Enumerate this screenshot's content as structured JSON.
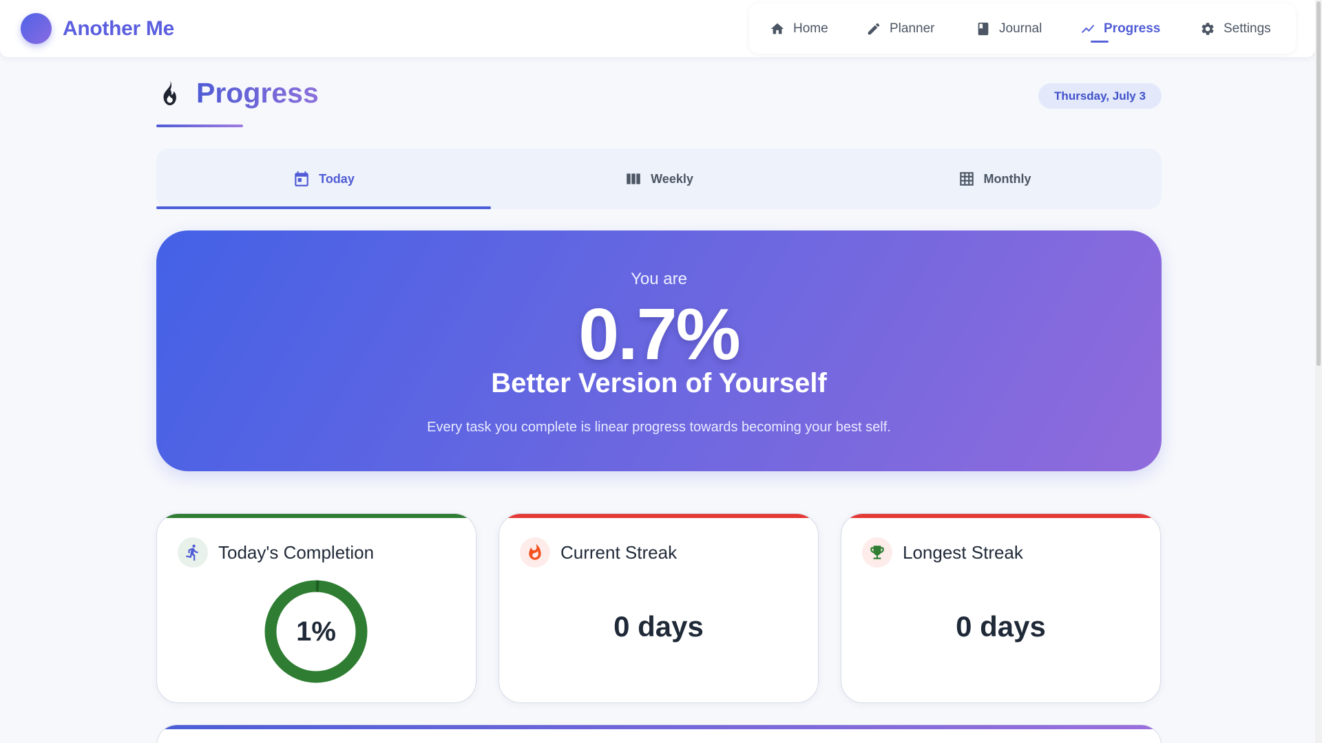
{
  "app": {
    "name": "Another Me"
  },
  "nav": {
    "items": [
      {
        "label": "Home",
        "icon": "home-icon"
      },
      {
        "label": "Planner",
        "icon": "pencil-icon"
      },
      {
        "label": "Journal",
        "icon": "book-icon"
      },
      {
        "label": "Progress",
        "icon": "trending-up-icon",
        "active": true
      },
      {
        "label": "Settings",
        "icon": "gear-icon"
      }
    ]
  },
  "page": {
    "title": "Progress",
    "title_icon": "flame-icon",
    "date": "Thursday, July 3"
  },
  "tabs": [
    {
      "label": "Today",
      "icon": "calendar-icon",
      "active": true
    },
    {
      "label": "Weekly",
      "icon": "weekly-columns-icon"
    },
    {
      "label": "Monthly",
      "icon": "grid-icon"
    }
  ],
  "hero": {
    "pre": "You are",
    "percent": "0.7%",
    "title": "Better Version of Yourself",
    "description": "Every task you complete is linear progress towards becoming your best self."
  },
  "cards": {
    "completion": {
      "title": "Today's Completion",
      "value": "1%",
      "progress": 0.01,
      "icon": "running-icon",
      "accent": "#2e7d32"
    },
    "current_streak": {
      "title": "Current Streak",
      "value": "0 days",
      "icon": "fire-icon",
      "accent": "#e53935"
    },
    "longest_streak": {
      "title": "Longest Streak",
      "value": "0 days",
      "icon": "trophy-icon",
      "accent": "#e53935"
    }
  },
  "colors": {
    "brand": "#5b5fdf",
    "accent": "#4f5bd5",
    "hero_start": "#4461e6",
    "hero_end": "#906bdc"
  }
}
